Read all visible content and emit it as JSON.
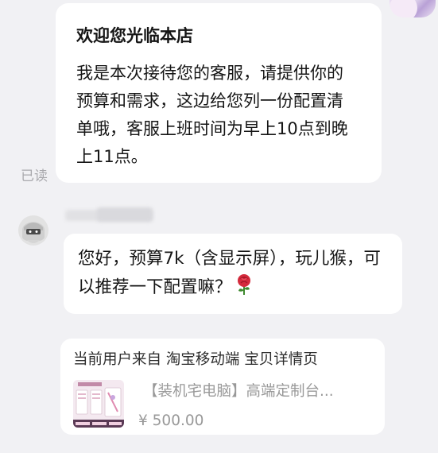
{
  "merchant_message": {
    "title": "欢迎您光临本店",
    "body": "我是本次接待您的客服，请提供你的预算和需求，这边给您列一份配置清单哦，客服上班时间为早上10点到晚上11点。"
  },
  "read_status": "已读",
  "user_message": {
    "text": "您好，预算7k（含显示屏），玩儿猴，可以推荐一下配置嘛？",
    "emoji": "rose-icon"
  },
  "product_card": {
    "source": "当前用户来自 淘宝移动端 宝贝详情页",
    "title": "【装机宅电脑】高端定制台...",
    "price": "¥ 500.00"
  },
  "colors": {
    "background": "#f1f1f4",
    "bubble": "#ffffff",
    "muted_text": "#999999"
  }
}
